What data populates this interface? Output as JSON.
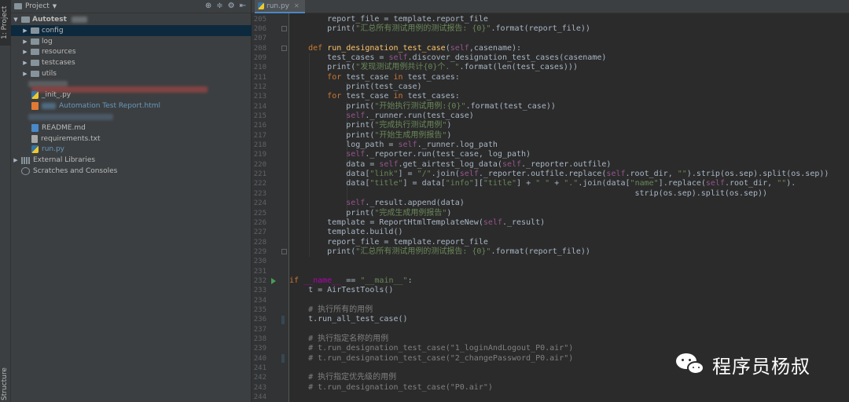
{
  "sidebar_tabs": {
    "project": "1: Project",
    "structure": "Structure"
  },
  "project_panel": {
    "title": "Project",
    "tree": [
      {
        "label": "Autotest",
        "kind": "root-folder",
        "expanded": true
      },
      {
        "label": "config",
        "kind": "folder"
      },
      {
        "label": "log",
        "kind": "folder"
      },
      {
        "label": "resources",
        "kind": "folder"
      },
      {
        "label": "testcases",
        "kind": "folder"
      },
      {
        "label": "utils",
        "kind": "folder"
      },
      {
        "label": "_init_.py",
        "kind": "py"
      },
      {
        "label": "Automation Test Report.html",
        "kind": "html"
      },
      {
        "label": "README.md",
        "kind": "md"
      },
      {
        "label": "requirements.txt",
        "kind": "txt"
      },
      {
        "label": "run.py",
        "kind": "py"
      },
      {
        "label": "External Libraries",
        "kind": "lib"
      },
      {
        "label": "Scratches and Consoles",
        "kind": "scratch"
      }
    ]
  },
  "editor": {
    "tab_label": "run.py",
    "line_numbers": [
      "205",
      "206",
      "207",
      "208",
      "209",
      "210",
      "211",
      "212",
      "213",
      "214",
      "215",
      "216",
      "217",
      "218",
      "219",
      "220",
      "221",
      "222",
      "223",
      "224",
      "225",
      "226",
      "227",
      "228",
      "229",
      "230",
      "231",
      "232",
      "233",
      "234",
      "235",
      "236",
      "237",
      "238",
      "239",
      "240",
      "241",
      "242",
      "243",
      "244"
    ],
    "lines": [
      "        report_file = template.report_file",
      "        print(\"汇总所有测试用例的测试报告: {0}\".format(report_file))",
      "",
      "    def run_designation_test_case(self,casename):",
      "        test_cases = self.discover_designation_test_cases(casename)",
      "        print(\"发现测试用例共计{0}个. \".format(len(test_cases)))",
      "        for test_case in test_cases:",
      "            print(test_case)",
      "        for test_case in test_cases:",
      "            print(\"开始执行测试用例:{0}\".format(test_case))",
      "            self._runner.run(test_case)",
      "            print(\"完成执行测试用例\")",
      "            print(\"开始生成用例报告\")",
      "            log_path = self._runner.log_path",
      "            self._reporter.run(test_case, log_path)",
      "            data = self.get_airtest_log_data(self._reporter.outfile)",
      "            data[\"link\"] = \"/\".join(self._reporter.outfile.replace(self.root_dir, \"\").strip(os.sep).split(os.sep))",
      "            data[\"title\"] = data[\"info\"][\"title\"] + \" \" + \".\".join(data[\"name\"].replace(self.root_dir, \"\").",
      "                                                                         strip(os.sep).split(os.sep))",
      "            self._result.append(data)",
      "            print(\"完成生成用例报告\")",
      "        template = ReportHtmlTemplateNew(self._result)",
      "        template.build()",
      "        report_file = template.report_file",
      "        print(\"汇总所有测试用例的测试报告: {0}\".format(report_file))",
      "",
      "",
      "if __name__ == \"__main__\":",
      "    t = AirTestTools()",
      "",
      "    # 执行所有的用例",
      "    t.run_all_test_case()",
      "",
      "    # 执行指定名称的用例",
      "    # t.run_designation_test_case(\"1_loginAndLogout_P0.air\")",
      "    # t.run_designation_test_case(\"2_changePassword_P0.air\")",
      "",
      "    # 执行指定优先级的用例",
      "    # t.run_designation_test_case(\"P0.air\")",
      ""
    ]
  },
  "watermark": {
    "text": "程序员杨叔",
    "icon": "wechat-icon"
  },
  "colors": {
    "background": "#2b2b2b",
    "panel": "#3c3f41",
    "keyword": "#cc7832",
    "function": "#ffc66d",
    "string": "#6a8759",
    "self": "#94558d",
    "comment": "#808080"
  }
}
